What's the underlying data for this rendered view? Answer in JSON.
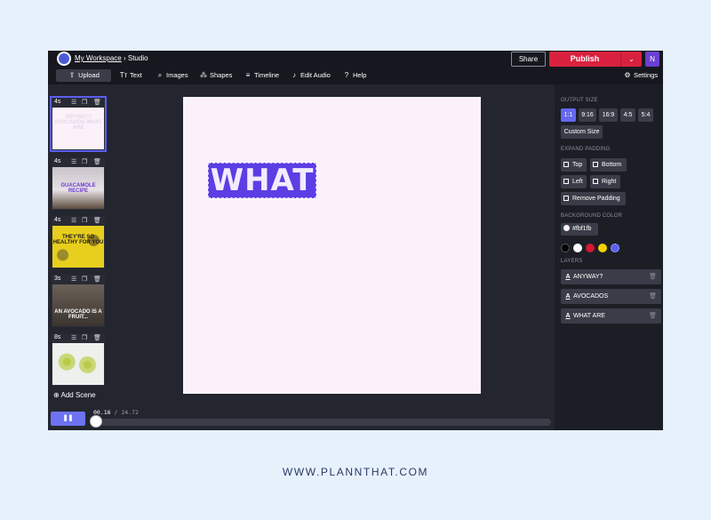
{
  "topbar": {
    "workspace": "My Workspace",
    "separator": " › ",
    "project": "Studio",
    "share": "Share",
    "publish": "Publish",
    "caret": "⌄",
    "avatar": "N"
  },
  "toolbar": {
    "upload": "Upload",
    "text": "Text",
    "images": "Images",
    "shapes": "Shapes",
    "timeline": "Timeline",
    "edit_audio": "Edit Audio",
    "help": "Help",
    "settings": "Settings"
  },
  "scenes": [
    {
      "duration": "4s",
      "thumb_text": "ANYWAY? AVOCADOS WHAT ARE"
    },
    {
      "duration": "4s",
      "thumb_text": "GUACAMOLE RECIPE"
    },
    {
      "duration": "4s",
      "thumb_text": "THEY'RE SO HEALTHY FOR YOU"
    },
    {
      "duration": "3s",
      "thumb_text": "AN AVOCADO IS A FRUIT..."
    },
    {
      "duration": "8s",
      "thumb_text": ""
    }
  ],
  "add_scene": "Add Scene",
  "canvas": {
    "background": "#fbf1fb",
    "text": "WHAT"
  },
  "timeline": {
    "current": "00.16",
    "divider": " / ",
    "total": "24.72",
    "play_icon": "❚❚",
    "progress": 0.006
  },
  "panel": {
    "output_size": {
      "title": "OUTPUT SIZE",
      "options": [
        "1:1",
        "9:16",
        "16:9",
        "4:5",
        "5:4"
      ],
      "selected": "1:1",
      "custom": "Custom Size"
    },
    "expand_padding": {
      "title": "EXPAND PADDING",
      "top": "Top",
      "bottom": "Bottom",
      "left": "Left",
      "right": "Right",
      "remove": "Remove Padding"
    },
    "background_color": {
      "title": "BACKGROUND COLOR",
      "value": "#fbf1fb",
      "swatches": [
        "#000000",
        "#ffffff",
        "#d5172f",
        "#f4d000",
        "#5b5ff2"
      ]
    },
    "layers": {
      "title": "LAYERS",
      "items": [
        "ANYWAY?",
        "AVOCADOS",
        "WHAT ARE"
      ]
    }
  },
  "footer": "WWW.PLANNTHAT.COM"
}
